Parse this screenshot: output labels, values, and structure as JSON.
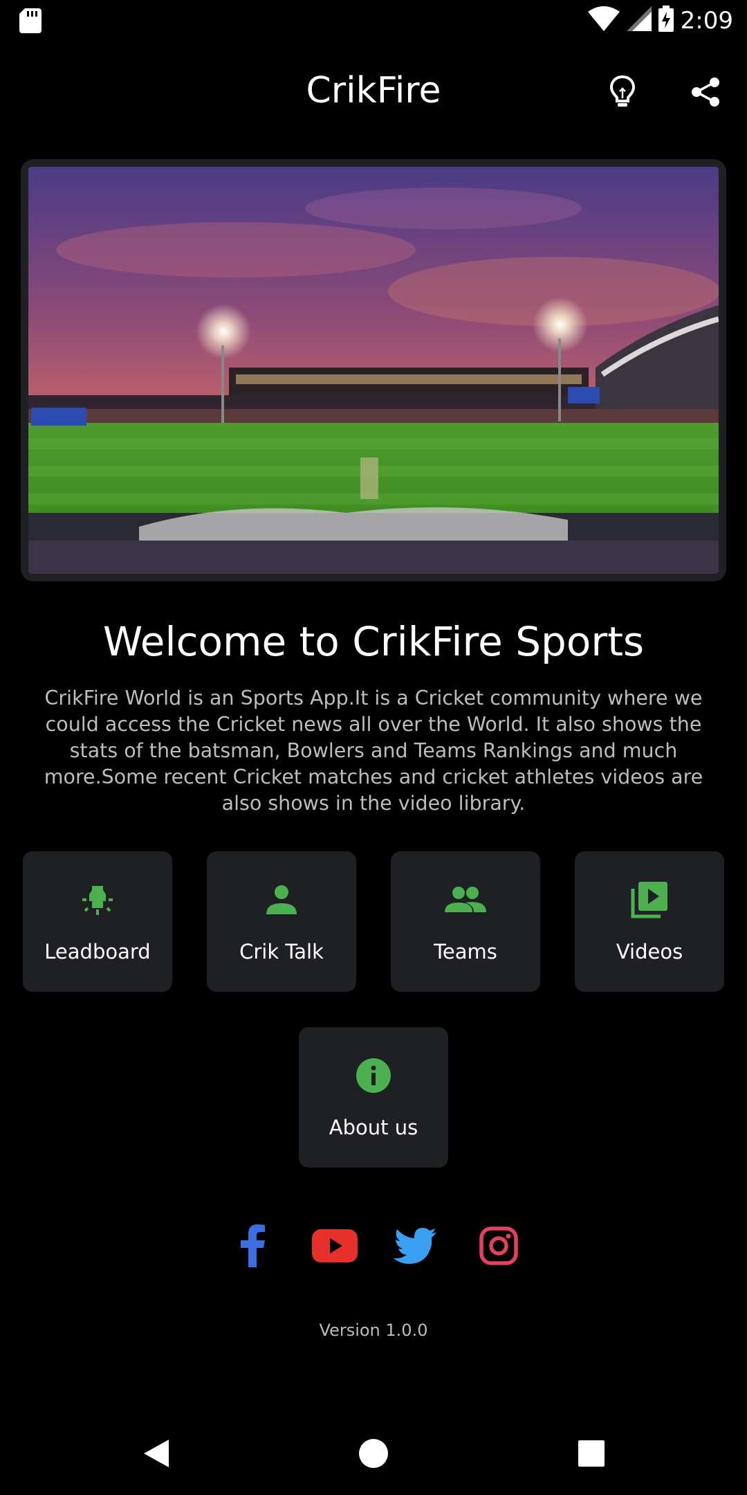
{
  "status_bar": {
    "time": "2:09",
    "icons": [
      "sd-card-icon",
      "wifi-icon",
      "cell-signal-icon",
      "battery-charging-icon"
    ]
  },
  "app_bar": {
    "title": "CrikFire",
    "actions": [
      "lightbulb-icon",
      "share-icon"
    ]
  },
  "hero": {
    "image": "cricket-stadium-image"
  },
  "welcome": {
    "heading": "Welcome to CrikFire Sports",
    "description": "CrikFire World is an Sports App.It is a Cricket community where we could access the Cricket news all over the World. It also shows the stats of the batsman, Bowlers and Teams Rankings and much more.Some recent Cricket matches and cricket athletes videos are also shows in the video library."
  },
  "menu": {
    "accent_color": "#4caf50",
    "tiles": [
      {
        "label": "Leadboard",
        "icon": "highlight-icon"
      },
      {
        "label": "Crik Talk",
        "icon": "person-icon"
      },
      {
        "label": "Teams",
        "icon": "people-icon"
      },
      {
        "label": "Videos",
        "icon": "video-library-icon"
      },
      {
        "label": "About us",
        "icon": "info-icon"
      }
    ]
  },
  "social": {
    "icons": [
      {
        "name": "facebook-icon",
        "color": "#3b6fe0"
      },
      {
        "name": "youtube-icon",
        "color": "#e8302a"
      },
      {
        "name": "twitter-icon",
        "color": "#3aa1f2"
      },
      {
        "name": "instagram-icon",
        "color": "#e4405f"
      }
    ]
  },
  "footer": {
    "version": "Version 1.0.0"
  },
  "nav_bar": {
    "buttons": [
      "back-icon",
      "home-icon",
      "recents-icon"
    ]
  }
}
